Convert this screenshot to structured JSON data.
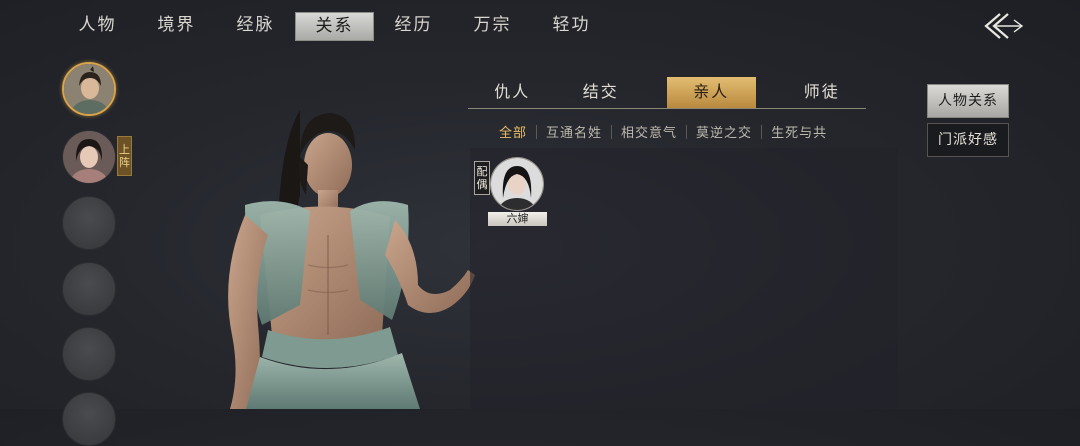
{
  "top_tabs": [
    {
      "label": "人物",
      "active": false
    },
    {
      "label": "境界",
      "active": false
    },
    {
      "label": "经脉",
      "active": false
    },
    {
      "label": "关系",
      "active": true
    },
    {
      "label": "经历",
      "active": false
    },
    {
      "label": "万宗",
      "active": false
    },
    {
      "label": "轻功",
      "active": false
    }
  ],
  "back_button": {
    "icon": "back-arrow-icon"
  },
  "roster": {
    "deploy_label": "上阵",
    "slots": [
      "selected-male-avatar",
      "female-avatar",
      "empty",
      "empty",
      "empty",
      "empty"
    ]
  },
  "relation_tabs": [
    {
      "label": "仇人",
      "active": false
    },
    {
      "label": "结交",
      "active": false
    },
    {
      "label": "亲人",
      "active": true
    },
    {
      "label": "师徒",
      "active": false
    }
  ],
  "sub_filters": [
    {
      "label": "全部",
      "active": true
    },
    {
      "label": "互通名姓",
      "active": false
    },
    {
      "label": "相交意气",
      "active": false
    },
    {
      "label": "莫逆之交",
      "active": false
    },
    {
      "label": "生死与共",
      "active": false
    }
  ],
  "relations": [
    {
      "tag": "配偶",
      "name": "六婶"
    }
  ],
  "side_buttons": {
    "character_relations": "人物关系",
    "sect_favor": "门派好感"
  },
  "colors": {
    "accent_gold": "#d9a44a",
    "active_tab_gold": "#c99a4e",
    "background": "#26282e"
  }
}
